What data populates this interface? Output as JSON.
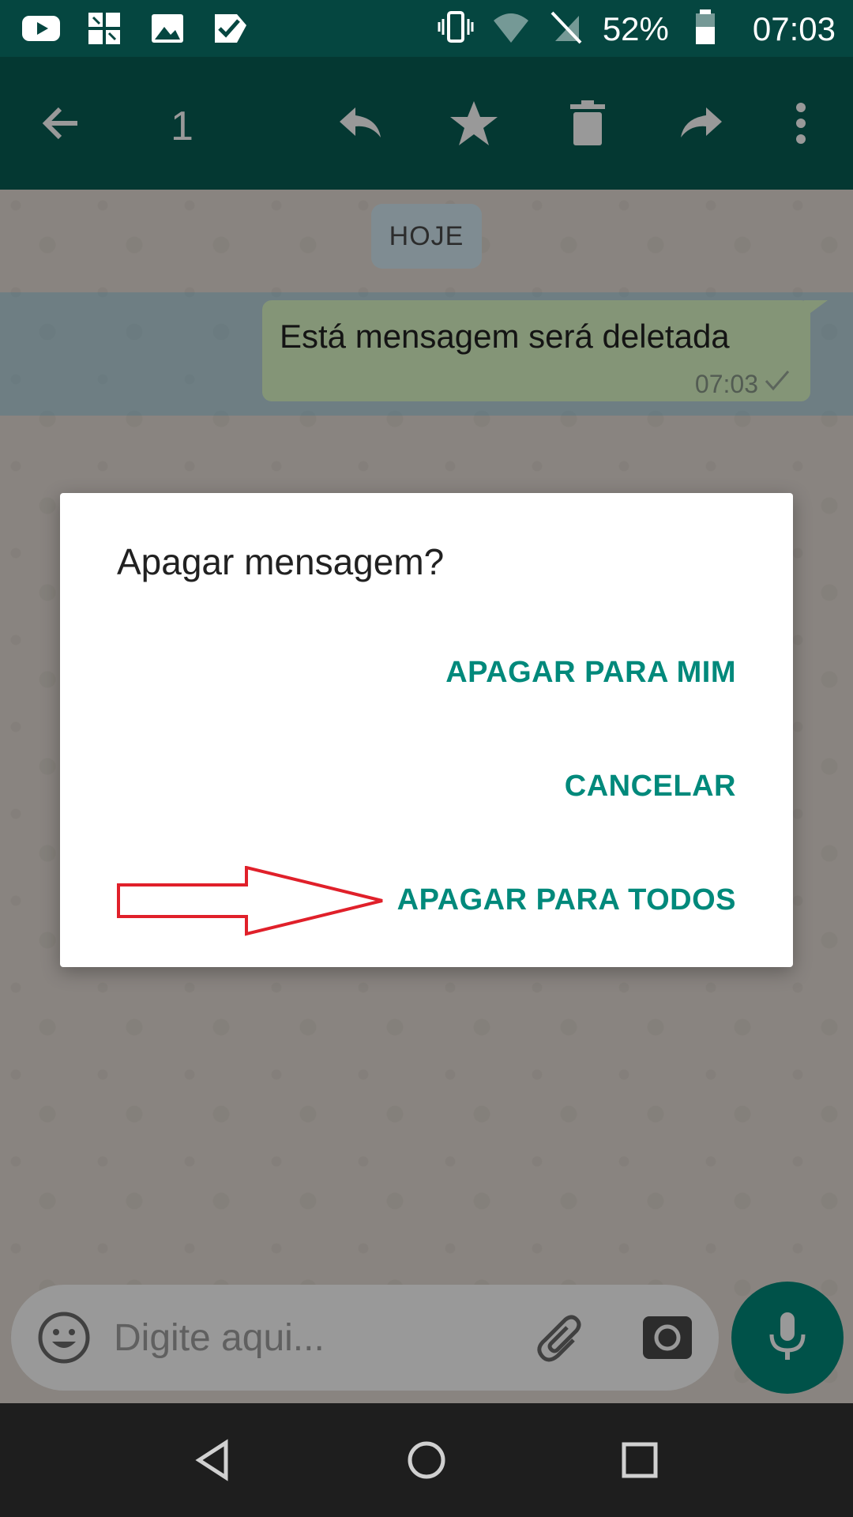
{
  "status_bar": {
    "battery_percent": "52%",
    "time": "07:03",
    "left_icons": [
      "youtube-icon",
      "puzzle-app-icon",
      "gallery-icon",
      "task-check-icon"
    ],
    "right_icons": [
      "vibrate-icon",
      "wifi-icon",
      "no-signal-icon",
      "battery-icon"
    ]
  },
  "app_bar": {
    "selected_count": "1",
    "actions": [
      "back-arrow-icon",
      "reply-icon",
      "star-icon",
      "delete-icon",
      "forward-icon",
      "overflow-menu-icon"
    ]
  },
  "chat": {
    "date_chip": "HOJE",
    "message": {
      "text": "Está mensagem será deletada",
      "time": "07:03",
      "status": "sent-check"
    }
  },
  "dialog": {
    "title": "Apagar mensagem?",
    "buttons": {
      "delete_for_me": "APAGAR PARA MIM",
      "cancel": "CANCELAR",
      "delete_for_everyone": "APAGAR PARA TODOS"
    },
    "annotation_color": "#e0202a"
  },
  "composer": {
    "placeholder": "Digite aqui..."
  },
  "colors": {
    "app_bar": "#075e54",
    "status_bar": "#054640",
    "accent": "#00897b",
    "bubble_out": "#dcf8c6",
    "chat_bg": "#e5ddd5"
  }
}
